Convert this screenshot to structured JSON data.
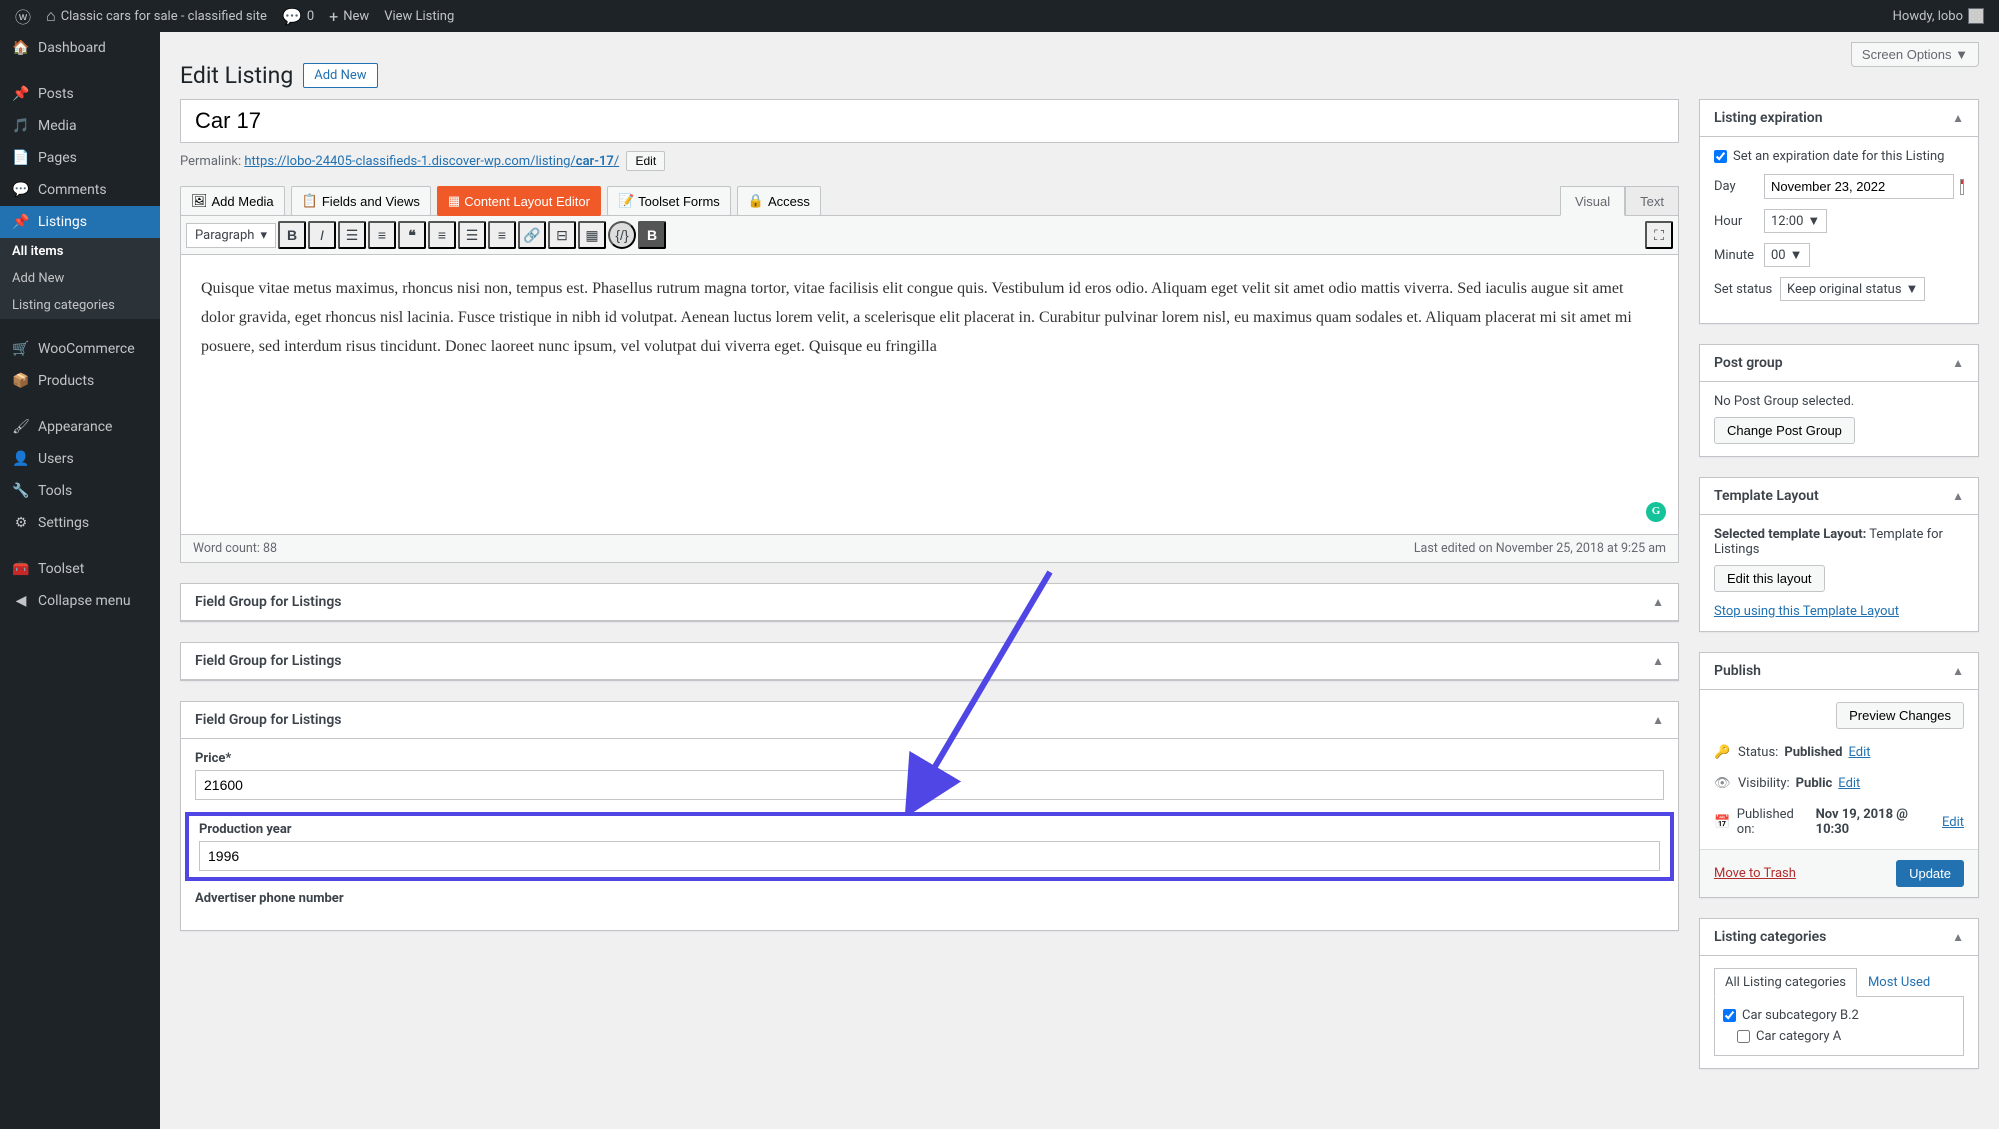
{
  "adminbar": {
    "site_name": "Classic cars for sale - classified site",
    "comments_count": "0",
    "new_label": "New",
    "view_listing_label": "View Listing",
    "howdy": "Howdy, lobo"
  },
  "sidebar": {
    "items": [
      {
        "label": "Dashboard",
        "icon": "dashboard"
      },
      {
        "label": "Posts",
        "icon": "pin"
      },
      {
        "label": "Media",
        "icon": "media"
      },
      {
        "label": "Pages",
        "icon": "pages"
      },
      {
        "label": "Comments",
        "icon": "comment"
      },
      {
        "label": "Listings",
        "icon": "pin"
      },
      {
        "label": "WooCommerce",
        "icon": "cart"
      },
      {
        "label": "Products",
        "icon": "products"
      },
      {
        "label": "Appearance",
        "icon": "brush"
      },
      {
        "label": "Users",
        "icon": "users"
      },
      {
        "label": "Tools",
        "icon": "tools"
      },
      {
        "label": "Settings",
        "icon": "settings"
      },
      {
        "label": "Toolset",
        "icon": "toolset"
      },
      {
        "label": "Collapse menu",
        "icon": "collapse"
      }
    ],
    "sub_items": [
      {
        "label": "All items"
      },
      {
        "label": "Add New"
      },
      {
        "label": "Listing categories"
      }
    ]
  },
  "screen_options": "Screen Options",
  "page_title": "Edit Listing",
  "add_new": "Add New",
  "title_value": "Car 17",
  "permalink_label": "Permalink:",
  "permalink_base": "https://lobo-24405-classifieds-1.discover-wp.com/listing/",
  "permalink_slug": "car-17",
  "permalink_slash": "/",
  "edit_btn": "Edit",
  "media_buttons": [
    {
      "label": "Add Media",
      "name": "add-media"
    },
    {
      "label": "Fields and Views",
      "name": "fields-views"
    },
    {
      "label": "Content Layout Editor",
      "name": "content-layout",
      "active": true
    },
    {
      "label": "Toolset Forms",
      "name": "toolset-forms"
    },
    {
      "label": "Access",
      "name": "access"
    }
  ],
  "editor_tabs": {
    "visual": "Visual",
    "text": "Text"
  },
  "tinymce_format": "Paragraph",
  "editor_content": "Quisque vitae metus maximus, rhoncus nisi non, tempus est. Phasellus rutrum magna tortor, vitae facilisis elit congue quis. Vestibulum id eros odio. Aliquam eget velit sit amet odio mattis viverra. Sed iaculis augue sit amet dolor gravida, eget rhoncus nisl lacinia. Fusce tristique in nibh id volutpat. Aenean luctus lorem velit, a scelerisque elit placerat in. Curabitur pulvinar lorem nisl, eu maximus quam sodales et. Aliquam placerat mi sit amet mi posuere, sed interdum risus tincidunt. Donec laoreet nunc ipsum, vel volutpat dui viverra eget. Quisque eu fringilla",
  "word_count": "Word count: 88",
  "last_edited": "Last edited on November 25, 2018 at 9:25 am",
  "field_group_title": "Field Group for Listings",
  "fields": {
    "price_label": "Price*",
    "price_value": "21600",
    "year_label": "Production year",
    "year_value": "1996",
    "phone_label": "Advertiser phone number"
  },
  "side": {
    "expiration": {
      "title": "Listing expiration",
      "checkbox_label": "Set an expiration date for this Listing",
      "day_label": "Day",
      "day_value": "November 23, 2022",
      "hour_label": "Hour",
      "hour_value": "12:00",
      "minute_label": "Minute",
      "minute_value": "00",
      "status_label": "Set status",
      "status_value": "Keep original status"
    },
    "post_group": {
      "title": "Post group",
      "none": "No Post Group selected.",
      "change": "Change Post Group"
    },
    "template": {
      "title": "Template Layout",
      "selected_label": "Selected template Layout:",
      "selected_value": "Template for Listings",
      "edit": "Edit this layout",
      "stop": "Stop using this Template Layout"
    },
    "publish": {
      "title": "Publish",
      "preview": "Preview Changes",
      "status_label": "Status:",
      "status_value": "Published",
      "visibility_label": "Visibility:",
      "visibility_value": "Public",
      "published_label": "Published on:",
      "published_value": "Nov 19, 2018 @ 10:30",
      "edit": "Edit",
      "trash": "Move to Trash",
      "update": "Update"
    },
    "categories": {
      "title": "Listing categories",
      "tabs": {
        "all": "All Listing categories",
        "most": "Most Used"
      },
      "items": [
        {
          "label": "Car subcategory B.2",
          "checked": true
        },
        {
          "label": "Car category A",
          "checked": false
        }
      ]
    }
  }
}
